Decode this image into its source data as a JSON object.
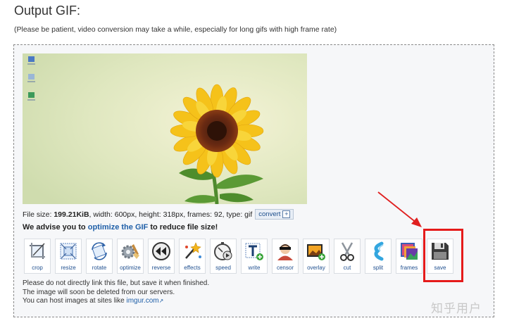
{
  "page": {
    "title": "Output GIF:",
    "note": "(Please be patient, video conversion may take a while, especially for long gifs with high frame rate)"
  },
  "file_info": {
    "prefix": "File size: ",
    "size": "199.21KiB",
    "details": ", width: 600px, height: 318px, frames: 92, type: gif",
    "convert_label": "convert",
    "convert_plus": "+"
  },
  "advice": {
    "before": "We advise you to ",
    "link": "optimize the GIF",
    "after": " to reduce file size!"
  },
  "tools": [
    {
      "id": "crop",
      "label": "crop"
    },
    {
      "id": "resize",
      "label": "resize"
    },
    {
      "id": "rotate",
      "label": "rotate"
    },
    {
      "id": "optimize",
      "label": "optimize"
    },
    {
      "id": "reverse",
      "label": "reverse"
    },
    {
      "id": "effects",
      "label": "effects"
    },
    {
      "id": "speed",
      "label": "speed"
    },
    {
      "id": "write",
      "label": "write"
    },
    {
      "id": "censor",
      "label": "censor"
    },
    {
      "id": "overlay",
      "label": "overlay"
    },
    {
      "id": "cut",
      "label": "cut"
    },
    {
      "id": "split",
      "label": "split"
    },
    {
      "id": "frames",
      "label": "frames"
    },
    {
      "id": "save",
      "label": "save"
    }
  ],
  "footer": {
    "line1": "Please do not directly link this file, but save it when finished.",
    "line2": "The image will soon be deleted from our servers.",
    "line3_before": "You can host images at sites like ",
    "line3_link": "imgur.com"
  },
  "watermark": "知乎用户",
  "colors": {
    "highlight": "#e51b1b",
    "link": "#1f5fa8",
    "arrow": "#e02020"
  }
}
